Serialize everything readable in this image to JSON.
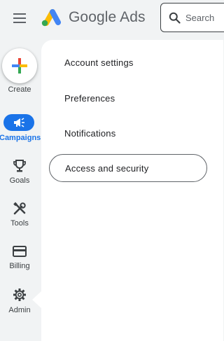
{
  "header": {
    "menu_icon": "hamburger-menu-icon",
    "logo_icon": "google-ads-logo",
    "brand": "Google Ads",
    "search": {
      "icon": "search-icon",
      "label": "Search"
    }
  },
  "rail": {
    "create": {
      "icon": "plus-multicolor-icon",
      "label": "Create"
    },
    "items": [
      {
        "icon": "megaphone-icon",
        "label": "Campaigns",
        "active": true
      },
      {
        "icon": "trophy-icon",
        "label": "Goals"
      },
      {
        "icon": "tools-icon",
        "label": "Tools"
      },
      {
        "icon": "credit-card-icon",
        "label": "Billing"
      },
      {
        "icon": "gear-icon",
        "label": "Admin"
      }
    ]
  },
  "admin_menu": {
    "items": [
      {
        "label": "Account settings"
      },
      {
        "label": "Preferences"
      },
      {
        "label": "Notifications"
      },
      {
        "label": "Access and security",
        "selected": true
      }
    ]
  },
  "colors": {
    "accent": "#1a73e8",
    "background": "#f1f3f4",
    "panel": "#ffffff"
  }
}
